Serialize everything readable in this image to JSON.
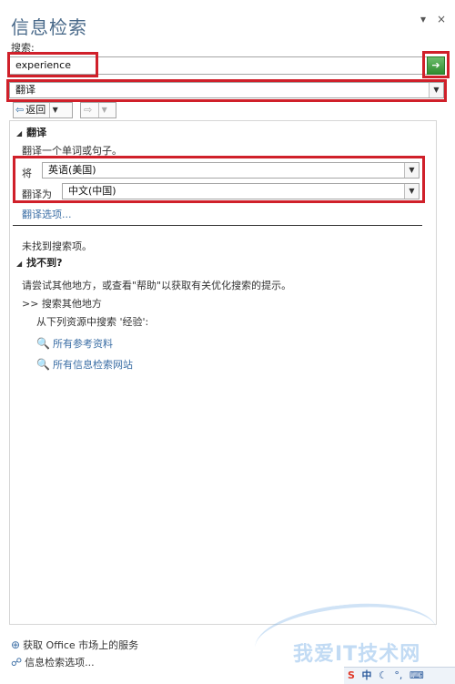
{
  "header": {
    "title": "信息检索",
    "menu_glyph": "▾",
    "close_glyph": "×"
  },
  "search": {
    "label": "搜索:",
    "value": "experience",
    "go_glyph": "➔"
  },
  "service": {
    "value": "翻译"
  },
  "nav": {
    "back_label": "返回",
    "back_glyph": "⇦",
    "forward_glyph": "⇨"
  },
  "translate": {
    "section_title": "翻译",
    "hint": "翻译一个单词或句子。",
    "from_label": "将",
    "from_value": "英语(美国)",
    "to_label": "翻译为",
    "to_value": "中文(中国)",
    "options_link": "翻译选项..."
  },
  "notfound": {
    "message": "未找到搜索项。",
    "cant_find_title": "找不到?",
    "advice": "请尝试其他地方，或查看\"帮助\"以获取有关优化搜索的提示。",
    "search_other_title": ">> 搜索其他地方",
    "search_in_label": "从下列资源中搜索 '经验':",
    "links": [
      "所有参考资料",
      "所有信息检索网站"
    ]
  },
  "footer": {
    "office_services": "获取 Office 市场上的服务",
    "research_options": "信息检索选项..."
  },
  "overlay": {
    "watermark": "我爱IT技术网",
    "tray_text": "中"
  }
}
